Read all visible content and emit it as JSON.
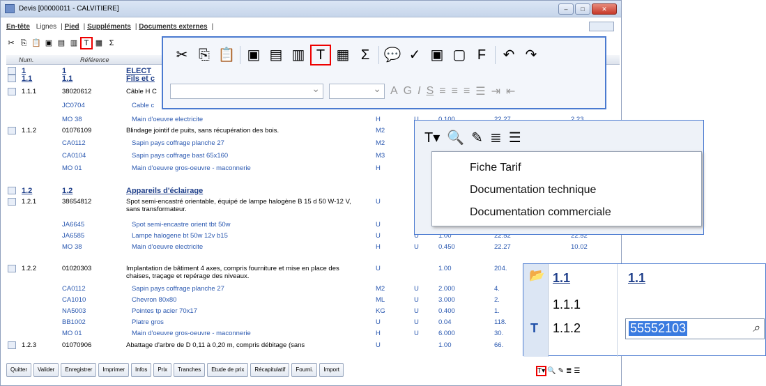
{
  "window": {
    "title": "Devis [00000011 - CALVITIERE]"
  },
  "tabs": [
    "En-tête",
    "Lignes",
    "Pied",
    "Suppléments",
    "Documents externes"
  ],
  "grid": {
    "headers": {
      "num": "Num.",
      "ref": "Référence"
    },
    "rows": [
      {
        "num": "1",
        "ref": "1",
        "label": "ELECT",
        "unit": "",
        "type": "",
        "qty": "",
        "price": "",
        "total": "",
        "style": "hdr"
      },
      {
        "num": "1.1",
        "ref": "1.1",
        "label": "Fils et c",
        "unit": "",
        "type": "",
        "qty": "",
        "price": "",
        "total": "",
        "style": "hdr"
      },
      {
        "num": "1.1.1",
        "ref": "38020612",
        "label": "Câble H C",
        "unit": "",
        "type": "",
        "qty": "",
        "price": "",
        "total": "",
        "style": "ouvrage"
      },
      {
        "num": "",
        "ref": "JC0704",
        "label": "Cable c",
        "unit": "",
        "type": "",
        "qty": "",
        "price": "",
        "total": "",
        "style": "comp"
      },
      {
        "num": "",
        "ref": "MO 38",
        "label": "Main d'oeuvre electricite",
        "unit": "H",
        "type": "U",
        "qty": "0.100",
        "price": "22.27",
        "total": "2.23",
        "style": "comp"
      },
      {
        "num": "1.1.2",
        "ref": "01076109",
        "label": "Blindage jointif de puits, sans récupération des bois.",
        "unit": "M2",
        "type": "",
        "qty": "",
        "price": "",
        "total": "",
        "style": "ouvrage"
      },
      {
        "num": "",
        "ref": "CA0112",
        "label": "Sapin pays coffrage planche 27",
        "unit": "M2",
        "type": "U",
        "qty": "",
        "price": "",
        "total": "",
        "style": "comp"
      },
      {
        "num": "",
        "ref": "CA0104",
        "label": "Sapin pays coffrage bast 65x160",
        "unit": "M3",
        "type": "U",
        "qty": "",
        "price": "",
        "total": "",
        "style": "comp"
      },
      {
        "num": "",
        "ref": "MO 01",
        "label": "Main d'oeuvre gros-oeuvre - maconnerie",
        "unit": "H",
        "type": "U",
        "qty": "",
        "price": "",
        "total": "",
        "style": "comp"
      },
      {
        "num": "1.2",
        "ref": "1.2",
        "label": "Appareils d'éclairage",
        "unit": "",
        "type": "",
        "qty": "",
        "price": "",
        "total": "",
        "style": "hdr"
      },
      {
        "num": "1.2.1",
        "ref": "38654812",
        "label": "Spot semi-encastré orientable, équipé de lampe halogène B 15 d 50 W-12 V, sans transformateur.",
        "unit": "U",
        "type": "",
        "qty": "",
        "price": "",
        "total": "",
        "style": "ouvrage"
      },
      {
        "num": "",
        "ref": "JA6645",
        "label": "Spot semi-encastre orient tbt 50w",
        "unit": "U",
        "type": "U",
        "qty": "",
        "price": "",
        "total": "",
        "style": "comp"
      },
      {
        "num": "",
        "ref": "JA6585",
        "label": "Lampe halogene bt 50w 12v b15",
        "unit": "U",
        "type": "U",
        "qty": "1.00",
        "price": "22.52",
        "total": "22.52",
        "style": "comp"
      },
      {
        "num": "",
        "ref": "MO 38",
        "label": "Main d'oeuvre electricite",
        "unit": "H",
        "type": "U",
        "qty": "0.450",
        "price": "22.27",
        "total": "10.02",
        "style": "comp"
      },
      {
        "num": "1.2.2",
        "ref": "01020303",
        "label": "Implantation de bâtiment 4 axes, compris fourniture et mise en place des chaises, traçage et repérage des niveaux.",
        "unit": "U",
        "type": "",
        "qty": "1.00",
        "price": "204.",
        "total": "",
        "style": "ouvrage"
      },
      {
        "num": "",
        "ref": "CA0112",
        "label": "Sapin pays coffrage planche 27",
        "unit": "M2",
        "type": "U",
        "qty": "2.000",
        "price": "4.",
        "total": "",
        "style": "comp"
      },
      {
        "num": "",
        "ref": "CA1010",
        "label": "Chevron 80x80",
        "unit": "ML",
        "type": "U",
        "qty": "3.000",
        "price": "2.",
        "total": "",
        "style": "comp"
      },
      {
        "num": "",
        "ref": "NA5003",
        "label": "Pointes tp acier 70x17",
        "unit": "KG",
        "type": "U",
        "qty": "0.400",
        "price": "1.",
        "total": "",
        "style": "comp"
      },
      {
        "num": "",
        "ref": "BB1002",
        "label": "Platre gros",
        "unit": "U",
        "type": "U",
        "qty": "0.04",
        "price": "118.",
        "total": "",
        "style": "comp"
      },
      {
        "num": "",
        "ref": "MO 01",
        "label": "Main d'oeuvre gros-oeuvre - maconnerie",
        "unit": "H",
        "type": "U",
        "qty": "6.000",
        "price": "30.",
        "total": "",
        "style": "comp"
      },
      {
        "num": "1.2.3",
        "ref": "01070906",
        "label": "Abattage d'arbre de D 0,11 à 0,20 m, compris débitage (sans",
        "unit": "U",
        "type": "",
        "qty": "1.00",
        "price": "66.",
        "total": "",
        "style": "ouvrage"
      }
    ]
  },
  "bottom_buttons": [
    "Quitter",
    "Valider",
    "Enregistrer",
    "Imprimer",
    "Infos",
    "Prix",
    "Tranches",
    "Etude de prix",
    "Récapitulatif",
    "Fourni.",
    "Import"
  ],
  "context_menu": [
    "Fiche Tarif",
    "Documentation technique",
    "Documentation commerciale"
  ],
  "zoom_panel": {
    "col1_header": "1.1",
    "col2_header": "1.1",
    "row_a": "1.1.1",
    "row_b": "1.1.2",
    "input_value": "55552103"
  },
  "toolbar_font": {
    "bold": "G",
    "italic": "I",
    "underline": "S",
    "fontcolor": "A"
  }
}
